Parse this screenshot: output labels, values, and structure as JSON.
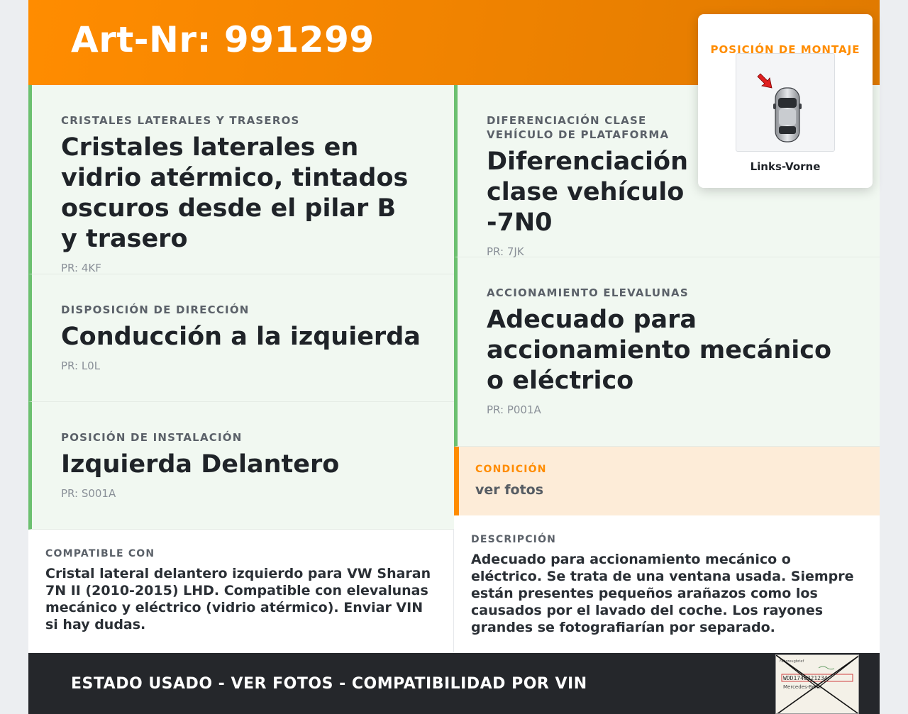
{
  "header": {
    "title": "Art-Nr: 991299"
  },
  "left_cells": [
    {
      "label": "CRISTALES LATERALES Y TRASEROS",
      "value": "Cristales laterales en vidrio atérmico, tintados oscuros desde el pilar B y trasero",
      "pr": "PR: 4KF"
    },
    {
      "label": "DISPOSICIÓN DE DIRECCIÓN",
      "value": "Conducción a la izquierda",
      "pr": "PR: L0L"
    },
    {
      "label": "POSICIÓN DE INSTALACIÓN",
      "value": "Izquierda Delantero",
      "pr": "PR: S001A"
    }
  ],
  "right_cells": [
    {
      "label": "DIFERENCIACIÓN CLASE VEHÍCULO DE PLATAFORMA",
      "value": "Diferenciación clase vehículo -7N0",
      "pr": "PR: 7JK"
    },
    {
      "label": "ACCIONAMIENTO ELEVALUNAS",
      "value": "Adecuado para accionamiento mecánico o eléctrico",
      "pr": "PR: P001A"
    }
  ],
  "condition": {
    "label": "CONDICIÓN",
    "value": "ver fotos"
  },
  "compatible": {
    "label": "COMPATIBLE CON",
    "text": "Cristal lateral delantero izquierdo para VW Sharan 7N II (2010-2015) LHD. Compatible con elevalunas mecánico y eléctrico (vidrio atérmico). Enviar VIN si hay dudas."
  },
  "description": {
    "label": "DESCRIPCIÓN",
    "text": "Adecuado para accionamiento mecánico o eléctrico. Se trata de una ventana usada. Siempre están presentes pequeños arañazos como los causados por el lavado del coche. Los rayones grandes se fotografiarían por separado."
  },
  "footer": {
    "text": "ESTADO USADO - VER FOTOS - COMPATIBILIDAD POR VIN",
    "stamp_top": "Fahrzeugbrief",
    "stamp_vin": "WDD1746321234",
    "stamp_bottom": "Mercedes-Benz"
  },
  "mount": {
    "title": "POSICIÓN DE MONTAJE",
    "caption": "Links-Vorne",
    "icon": "car-top-view-icon",
    "arrow_icon": "red-arrow-icon"
  },
  "colors": {
    "accent": "#ff8c00",
    "green_bar": "#6cc070",
    "cell_bg": "#f1f8f1",
    "condition_bg": "#fdecd8",
    "footer_bg": "#25272b",
    "arrow": "#e02020"
  }
}
